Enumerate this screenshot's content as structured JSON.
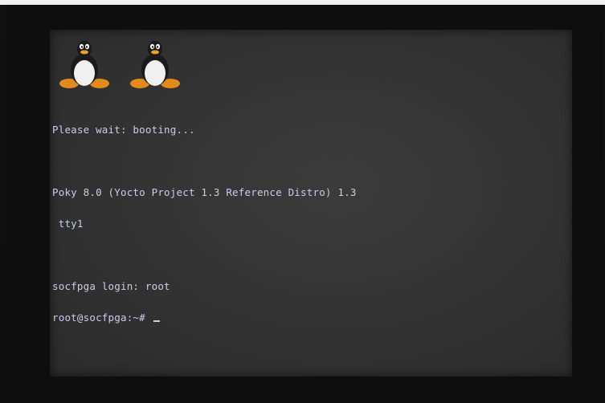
{
  "terminal": {
    "boot_message": "Please wait: booting...",
    "distro_line": "Poky 8.0 (Yocto Project 1.3 Reference Distro) 1.3",
    "tty_line": " tty1",
    "login_line": "socfpga login: root",
    "prompt": "root@socfpga:~# "
  },
  "icons": {
    "boot_logo": "tux-penguin-icon",
    "logo_count": 2
  },
  "colors": {
    "screen_background": "#343434",
    "text": "#c9ceea"
  }
}
